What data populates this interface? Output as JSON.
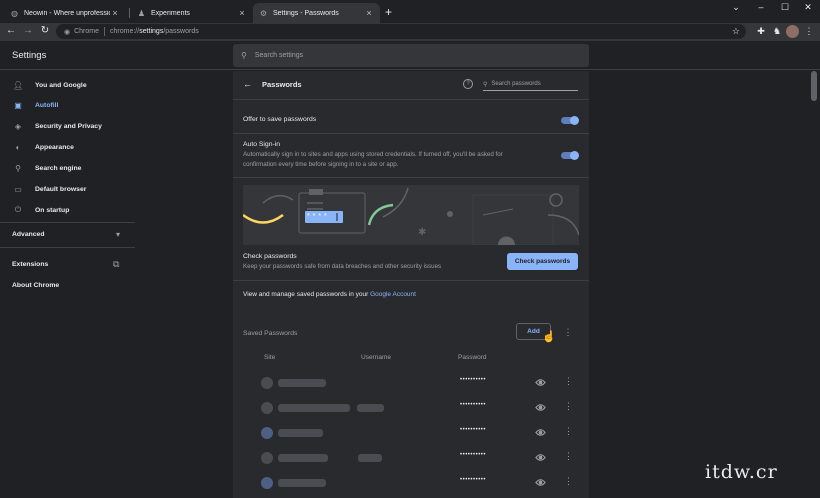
{
  "tabs": [
    {
      "title": "Neowin - Where unprofessional j",
      "icon": "neowin-icon"
    },
    {
      "title": "Experiments",
      "icon": "experiments-icon"
    },
    {
      "title": "Settings - Passwords",
      "icon": "gear-icon"
    }
  ],
  "omnibox": {
    "chip": "Chrome",
    "url_prefix": "chrome://",
    "url_host": "settings",
    "url_path": "/passwords"
  },
  "settings": {
    "title": "Settings",
    "search_placeholder": "Search settings"
  },
  "sidebar": {
    "items": [
      {
        "label": "You and Google",
        "icon": "person-icon"
      },
      {
        "label": "Autofill",
        "icon": "clipboard-icon"
      },
      {
        "label": "Security and Privacy",
        "icon": "shield-icon"
      },
      {
        "label": "Appearance",
        "icon": "palette-icon"
      },
      {
        "label": "Search engine",
        "icon": "search-icon"
      },
      {
        "label": "Default browser",
        "icon": "browser-icon"
      },
      {
        "label": "On startup",
        "icon": "power-icon"
      }
    ],
    "advanced": "Advanced",
    "extensions": "Extensions",
    "about": "About Chrome"
  },
  "passwords": {
    "title": "Passwords",
    "search_placeholder": "Search passwords",
    "offer_label": "Offer to save passwords",
    "auto_label": "Auto Sign-in",
    "auto_desc_1": "Automatically sign in to sites and apps using stored credentials. If turned off, you'll be asked for",
    "auto_desc_2": "confirmation every time before signing in to a site or app.",
    "banner_stars": "* * * *",
    "check_title": "Check passwords",
    "check_desc": "Keep your passwords safe from data breaches and other security issues",
    "check_button": "Check passwords",
    "manage_text": "View and manage saved passwords in your ",
    "manage_link": "Google Account",
    "saved_title": "Saved Passwords",
    "add_button": "Add",
    "col_site": "Site",
    "col_username": "Username",
    "col_password": "Password",
    "rows": [
      {
        "password": "••••••••••"
      },
      {
        "password": "••••••••••"
      },
      {
        "password": "••••••••••"
      },
      {
        "password": "••••••••••"
      },
      {
        "password": "••••••••••"
      }
    ]
  },
  "watermark": "itdw.cr",
  "colors": {
    "accent": "#8ab4f8",
    "background": "#202124",
    "panel": "#292a2d"
  }
}
